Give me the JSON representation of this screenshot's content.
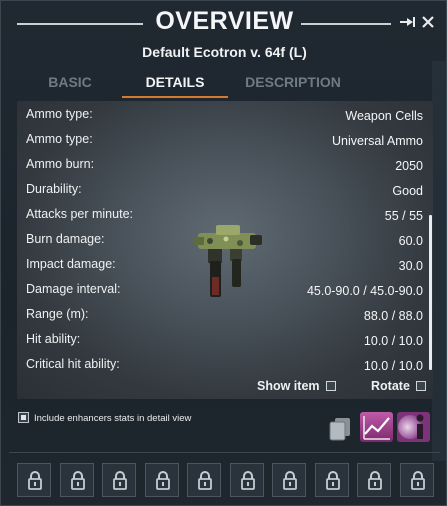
{
  "window": {
    "title": "OVERVIEW",
    "subtitle": "Default Ecotron v. 64f (L)"
  },
  "tabs": [
    {
      "label": "BASIC",
      "active": false
    },
    {
      "label": "DETAILS",
      "active": true
    },
    {
      "label": "DESCRIPTION",
      "active": false
    }
  ],
  "stats": [
    {
      "label": "Ammo type:",
      "value": "Weapon Cells"
    },
    {
      "label": "Ammo type:",
      "value": "Universal Ammo"
    },
    {
      "label": "Ammo burn:",
      "value": "2050"
    },
    {
      "label": "Durability:",
      "value": "Good"
    },
    {
      "label": "Attacks per minute:",
      "value": "55 / 55"
    },
    {
      "label": "Burn damage:",
      "value": "60.0"
    },
    {
      "label": "Impact damage:",
      "value": "30.0"
    },
    {
      "label": "Damage interval:",
      "value": "45.0-90.0 / 45.0-90.0"
    },
    {
      "label": "Range (m):",
      "value": "88.0 / 88.0"
    },
    {
      "label": "Hit ability:",
      "value": "10.0 / 10.0"
    },
    {
      "label": "Critical hit ability:",
      "value": "10.0 / 10.0"
    }
  ],
  "options": {
    "show_item": "Show item",
    "rotate": "Rotate"
  },
  "enhancers": {
    "label": "Include enhancers stats in detail view",
    "checked": true
  },
  "slots": {
    "count": 10,
    "icon": "lock-icon"
  },
  "colors": {
    "accent": "#d57a2e",
    "stats_button": "#a13a8e",
    "info_button": "#8c3f8e"
  }
}
